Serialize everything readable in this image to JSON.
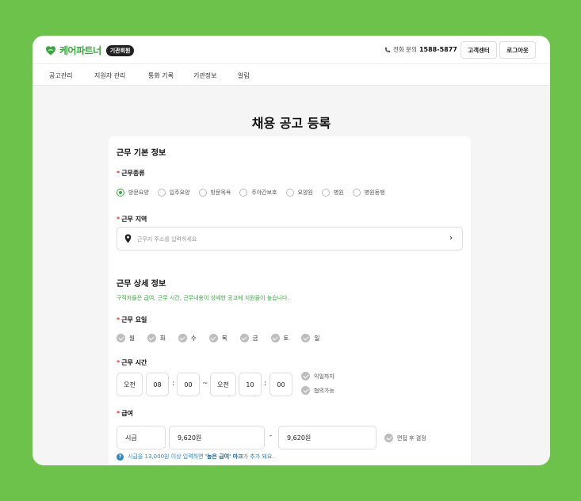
{
  "header": {
    "logo_text": "케어파트너",
    "badge": "기관회원",
    "phone_label": "전화 문의",
    "phone_number": "1588-5877",
    "customer_center": "고객센터",
    "logout": "로그아웃"
  },
  "nav": [
    "공고관리",
    "지원자 관리",
    "통화 기록",
    "기관정보",
    "알림"
  ],
  "page_title": "채용 공고 등록",
  "basic": {
    "title": "근무 기본 정보",
    "type_label": "근무종류",
    "types": [
      {
        "label": "방문요양",
        "selected": true
      },
      {
        "label": "입주요양",
        "selected": false
      },
      {
        "label": "방문목욕",
        "selected": false
      },
      {
        "label": "주야간보호",
        "selected": false
      },
      {
        "label": "요양원",
        "selected": false
      },
      {
        "label": "병원",
        "selected": false
      },
      {
        "label": "병원동행",
        "selected": false
      }
    ],
    "region_label": "근무 지역",
    "region_placeholder": "근무지 주소를 입력하세요"
  },
  "detail": {
    "title": "근무 상세 정보",
    "desc": "구직자들은 급여, 근무 시간, 근무내용이 상세한 공고에 지원율이 높습니다.",
    "days_label": "근무 요일",
    "days": [
      "월",
      "화",
      "수",
      "목",
      "금",
      "토",
      "일"
    ],
    "time_label": "근무 시간",
    "start": {
      "ampm": "오전",
      "hour": "08",
      "minute": "00"
    },
    "time_sep": "~",
    "colon": ":",
    "end": {
      "ampm": "오전",
      "hour": "10",
      "minute": "00"
    },
    "next_day": "익일까지",
    "negotiable": "협의가능",
    "salary_label": "급여",
    "salary_type": "시급",
    "salary_min": "9,620원",
    "salary_sep": "-",
    "salary_max": "9,620원",
    "after_interview": "면접 후 결정",
    "note_prefix": "시급을 13,000원 이상 입력하면 ",
    "note_bold": "'높은 급여' 마크",
    "note_suffix": "가 추가 돼요."
  },
  "colors": {
    "background": "#6cc24a",
    "accent": "#3aa63f",
    "required": "#e53935",
    "info": "#2e86c1"
  }
}
